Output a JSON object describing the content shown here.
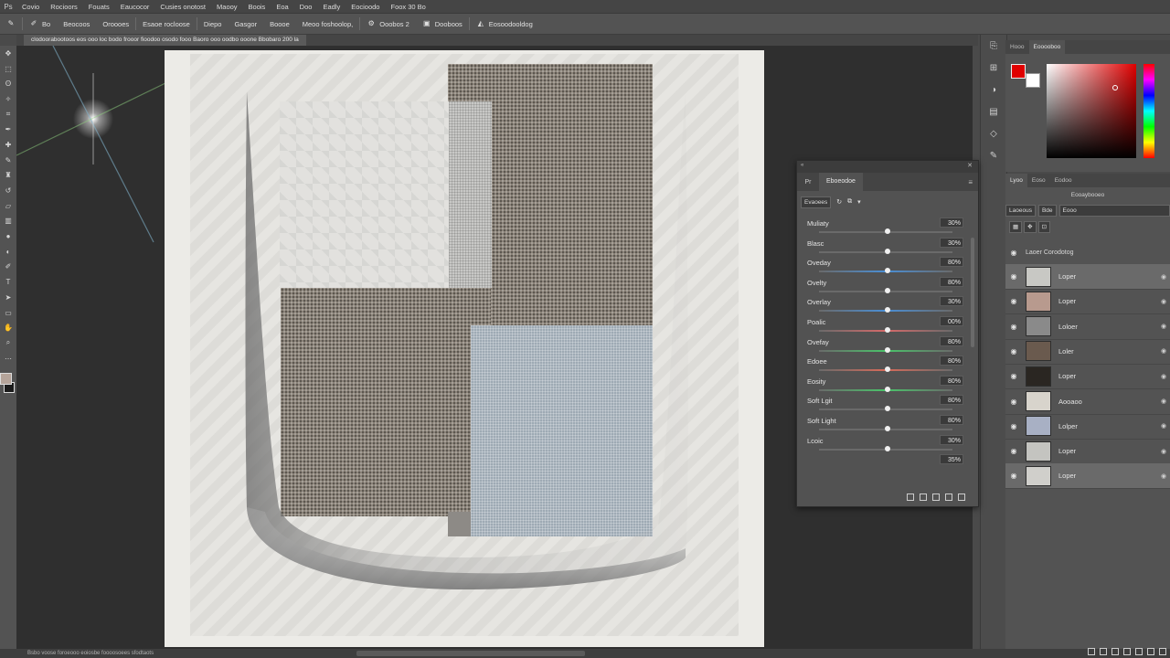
{
  "colors": {
    "foreground": "#e00000",
    "background": "#ffffff",
    "accent_selected_row": "#6a6a6a"
  },
  "menubar": {
    "items": [
      "Covio",
      "Rocioors",
      "Fouats",
      "Eaucocor",
      "Cusies onotost",
      "Maooy",
      "Boois",
      "Eoa",
      "Doo",
      "Eadly",
      "Eocioodo",
      "Foox 30 Bo"
    ]
  },
  "optionsbar": {
    "items": [
      "Bo",
      "Beocoos",
      "Oroooes",
      "Esaoe rocloose",
      "Diepo",
      "Gasgor",
      "Boooe",
      "Meoo foshoolop,",
      "Ooobos 2",
      "Dooboos",
      "Eosoodooldog"
    ]
  },
  "document": {
    "tab_title": "clodoorabootoos eos ooo loc bodo frooor fioodoo osodo fooo Baoro ooo oodbo ooone Bbobaro 200 la"
  },
  "status": {
    "text": "Bsbo voose foroeooo eoiosbe foooosoees sfodtaots"
  },
  "colorpanel": {
    "tabs": [
      "Hooo",
      "Eooooboo"
    ]
  },
  "layerspanel": {
    "tabs": [
      "Lyoo",
      "Eoso",
      "Eodoo"
    ],
    "subtitle": "Eooaybooeo",
    "blend_mode": "Laoeous",
    "opacity_label": "Bde",
    "opacity_value": "Eooo",
    "group": "Laoer Corodotog",
    "layers": [
      {
        "name": "Loper",
        "selected": true
      },
      {
        "name": "Loper",
        "selected": false
      },
      {
        "name": "Loloer",
        "selected": false
      },
      {
        "name": "Loler",
        "selected": false
      },
      {
        "name": "Loper",
        "selected": false
      },
      {
        "name": "Aooaoo",
        "selected": false
      },
      {
        "name": "Lolper",
        "selected": false
      },
      {
        "name": "Loper",
        "selected": false
      },
      {
        "name": "Loper",
        "selected": true
      }
    ]
  },
  "adjustments": {
    "tab_label": "Eboeodoe",
    "presets_label": "Evaoees",
    "rows": [
      {
        "name": "Muliaty",
        "value": "30%",
        "accent": "#6a6a6a"
      },
      {
        "name": "Blasc",
        "value": "30%",
        "accent": "#6a6a6a"
      },
      {
        "name": "Oveday",
        "value": "80%",
        "accent": "#4a8fd6"
      },
      {
        "name": "Ovelty",
        "value": "80%",
        "accent": "#6a6a6a"
      },
      {
        "name": "Overlay",
        "value": "30%",
        "accent": "#4a8fd6"
      },
      {
        "name": "Poalic",
        "value": "00%",
        "accent": "#d66a6a"
      },
      {
        "name": "Ovefay",
        "value": "80%",
        "accent": "#4ac46a"
      },
      {
        "name": "Edoee",
        "value": "80%",
        "accent": "#d66a5a"
      },
      {
        "name": "Eosity",
        "value": "80%",
        "accent": "#4ac46a"
      },
      {
        "name": "Soft Lgit",
        "value": "80%",
        "accent": "#6a6a6a"
      },
      {
        "name": "Soft Light",
        "value": "80%",
        "accent": "#6a6a6a"
      },
      {
        "name": "Lcoic",
        "value": "30%",
        "accent": "#6a6a6a"
      },
      {
        "name": "",
        "value": "35%",
        "accent": "#6a6a6a"
      }
    ]
  },
  "icons": {
    "tools": [
      "move-icon",
      "marquee-icon",
      "lasso-icon",
      "quick-select-icon",
      "crop-icon",
      "eyedropper-icon",
      "healing-icon",
      "brush-icon",
      "stamp-icon",
      "history-brush-icon",
      "eraser-icon",
      "gradient-icon",
      "blur-icon",
      "dodge-icon",
      "pen-icon",
      "type-icon",
      "path-select-icon",
      "shape-icon",
      "hand-icon",
      "zoom-icon",
      "edit-toolbar-icon",
      "quick-mask-icon",
      "screen-mode-icon"
    ],
    "right_column": [
      "history-icon",
      "properties-icon",
      "adjustments-icon",
      "libraries-icon",
      "channels-icon",
      "paths-icon"
    ]
  }
}
